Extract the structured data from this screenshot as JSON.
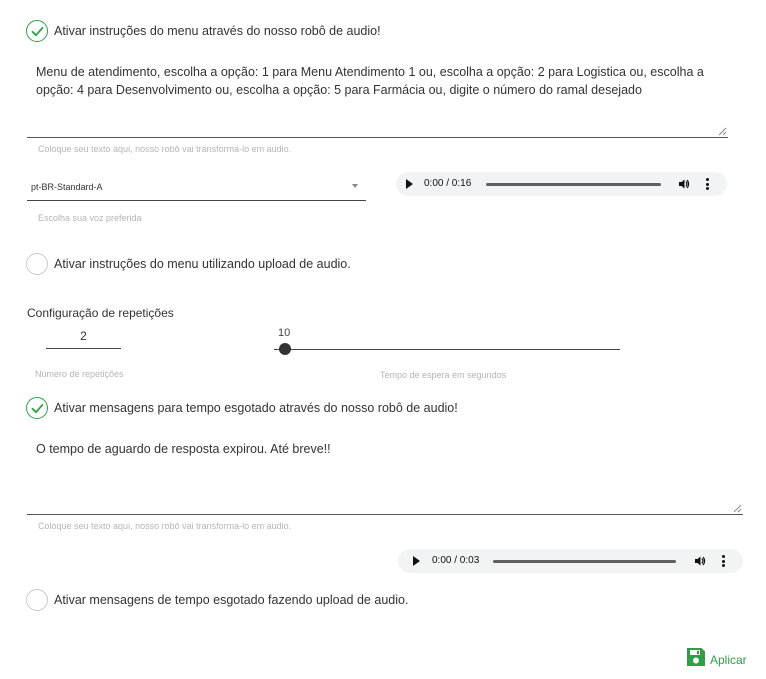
{
  "menu_tts": {
    "toggle_label": "Ativar instruções do menu através do nosso robô de audio!",
    "checked": true,
    "text": "Menu de atendimento, escolha a opção: 1 para Menu Atendimento 1 ou, escolha a opção: 2 para Logistica ou, escolha a opção: 4 para Desenvolvimento ou, escolha a opção: 5 para Farmácia ou, digite o número do ramal desejado",
    "hint": "Coloque seu texto aqui, nosso robô vai transforma-lo em audio.",
    "voice_value": "pt-BR-Standard-A",
    "voice_hint": "Escolha sua voz preferida",
    "audio_time": "0:00 / 0:16"
  },
  "menu_upload": {
    "toggle_label": "Ativar instruções do menu utilizando upload de audio.",
    "checked": false
  },
  "repeat_config": {
    "title": "Configuração de repetições",
    "repetitions_value": "2",
    "repetitions_hint": "Número de repetições",
    "wait_value": "10",
    "wait_hint": "Tempo de espera em segundos"
  },
  "timeout_tts": {
    "toggle_label": "Ativar mensagens para tempo esgotado através do nosso robô de audio!",
    "checked": true,
    "text": "O tempo de aguardo de resposta expirou. Até breve!!",
    "hint": "Coloque seu texto aqui, nosso robô vai transforma-lo em audio.",
    "audio_time": "0:00 / 0:03"
  },
  "timeout_upload": {
    "toggle_label": "Ativar mensagens de tempo esgotado fazendo upload de audio.",
    "checked": false
  },
  "actions": {
    "apply_label": "Aplicar"
  },
  "colors": {
    "accent_green": "#2e9e4a"
  },
  "icons": [
    "check-icon",
    "play-icon",
    "volume-icon",
    "more-vertical-icon",
    "save-icon",
    "dropdown-arrow-icon"
  ]
}
